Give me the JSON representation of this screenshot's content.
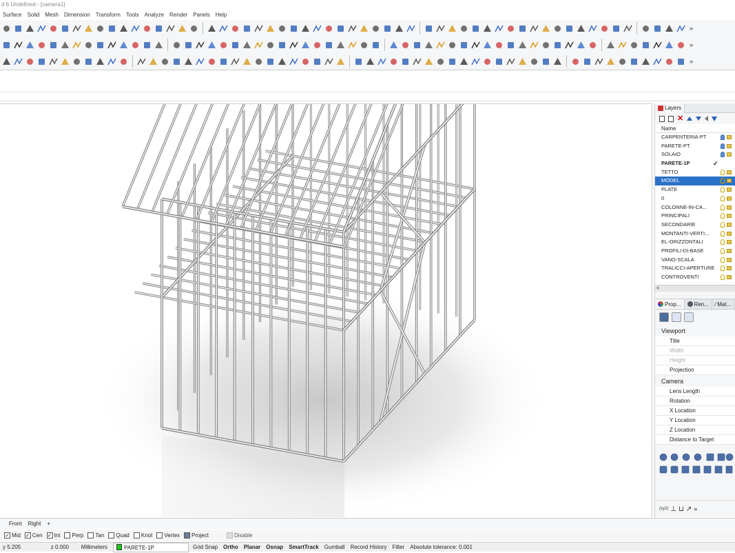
{
  "window": {
    "title": "d 6 Undefined - [camera1]"
  },
  "menu": [
    "Surface",
    "Solid",
    "Mesh",
    "Dimension",
    "Transform",
    "Tools",
    "Analyze",
    "Render",
    "Panels",
    "Help"
  ],
  "toolbar": {
    "more": "»"
  },
  "layers_panel": {
    "tab_label": "Layers",
    "column_header": "Name",
    "rows": [
      {
        "name": "CARPENTERIA-PT",
        "state": "normal"
      },
      {
        "name": "PARETE-PT",
        "state": "normal"
      },
      {
        "name": "SOLAIO",
        "state": "normal"
      },
      {
        "name": "PARETE-1P",
        "state": "current",
        "check": "✓"
      },
      {
        "name": "TETTO",
        "state": "normal"
      },
      {
        "name": "MODEL",
        "state": "selected"
      },
      {
        "name": "PLATE",
        "state": "normal"
      },
      {
        "name": "0",
        "state": "normal"
      },
      {
        "name": "COLONNE-IN-CA...",
        "state": "normal"
      },
      {
        "name": "PRINCIPALI",
        "state": "normal"
      },
      {
        "name": "SECONDARIE",
        "state": "normal"
      },
      {
        "name": "MONTANTI-VERTI...",
        "state": "normal"
      },
      {
        "name": "EL-ORIZZONTALI",
        "state": "normal"
      },
      {
        "name": "PROFILI-DI-BASE",
        "state": "normal"
      },
      {
        "name": "VANO-SCALA",
        "state": "normal"
      },
      {
        "name": "TRALICCI-APERTURE",
        "state": "normal"
      },
      {
        "name": "CONTROVENTI",
        "state": "normal"
      }
    ],
    "scroll_left": "<"
  },
  "properties_panel": {
    "tabs": [
      "Prop...",
      "Ren...",
      "Mat..."
    ],
    "viewport_section": "Viewport",
    "viewport_fields": [
      {
        "label": "Title",
        "disabled": false
      },
      {
        "label": "Width",
        "disabled": true
      },
      {
        "label": "Height",
        "disabled": true
      },
      {
        "label": "Projection",
        "disabled": false
      }
    ],
    "camera_section": "Camera",
    "camera_fields": [
      "Lens Length",
      "Rotation",
      "X Location",
      "Y Location",
      "Z Location",
      "Distance to Target"
    ],
    "snap_label": "(xy2)"
  },
  "viewport_tabs": [
    {
      "label": "Front",
      "active": false
    },
    {
      "label": "Right",
      "active": false
    },
    {
      "label": "+",
      "active": false
    }
  ],
  "osnaps": [
    {
      "label": "Mid",
      "checked": true
    },
    {
      "label": "Cen",
      "checked": true
    },
    {
      "label": "Int",
      "checked": true
    },
    {
      "label": "Perp",
      "checked": false
    },
    {
      "label": "Tan",
      "checked": false
    },
    {
      "label": "Quad",
      "checked": false
    },
    {
      "label": "Knot",
      "checked": false
    },
    {
      "label": "Vertex",
      "checked": false
    },
    {
      "label": "Project",
      "checked": true
    },
    {
      "label": "Disable",
      "checked": false
    }
  ],
  "status": {
    "y": "y 5.205",
    "z": "z 0.000",
    "units": "Millimeters",
    "layer": "PARETE-1P",
    "grid_snap": "Grid Snap",
    "ortho": "Ortho",
    "planar": "Planar",
    "osnap": "Osnap",
    "smarttrack": "SmartTrack",
    "gumball": "Gumball",
    "record_history": "Record History",
    "filter": "Filter",
    "tolerance": "Absolute tolerance: 0.001"
  },
  "colors": {
    "selection": "#2a72c8",
    "layer_swatch": "#1ec81e",
    "frame": "#c8c8c8"
  }
}
